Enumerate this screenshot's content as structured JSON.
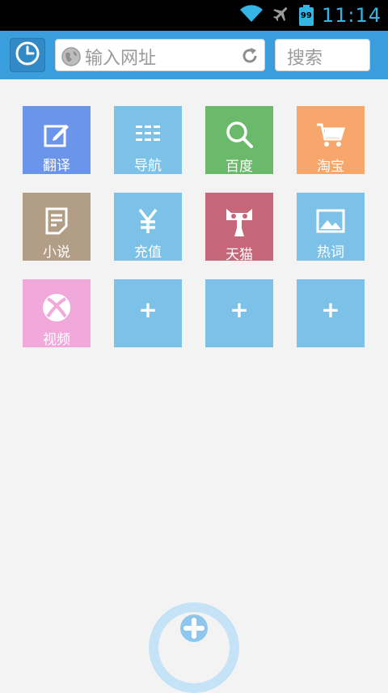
{
  "status": {
    "time": "11:14",
    "battery": "99"
  },
  "toolbar": {
    "url_placeholder": "输入网址",
    "search_placeholder": "搜索"
  },
  "grid": {
    "tiles": [
      {
        "label": "翻译",
        "icon": "edit-icon",
        "color": "#6a95ea"
      },
      {
        "label": "导航",
        "icon": "menu-list-icon",
        "color": "#7cc2e8"
      },
      {
        "label": "百度",
        "icon": "search-icon",
        "color": "#6bb96a"
      },
      {
        "label": "淘宝",
        "icon": "cart-icon",
        "color": "#f7a76b"
      },
      {
        "label": "小说",
        "icon": "document-icon",
        "color": "#b29d86"
      },
      {
        "label": "充值",
        "icon": "yen-icon",
        "color": "#7cc2e8"
      },
      {
        "label": "天猫",
        "icon": "tmall-cat-icon",
        "color": "#c7677a"
      },
      {
        "label": "热词",
        "icon": "image-icon",
        "color": "#7cc2e8"
      },
      {
        "label": "视频",
        "icon": "xbox-icon",
        "color": "#f1a9dc"
      }
    ],
    "add_label": "+",
    "add_color": "#7cc2e8"
  }
}
